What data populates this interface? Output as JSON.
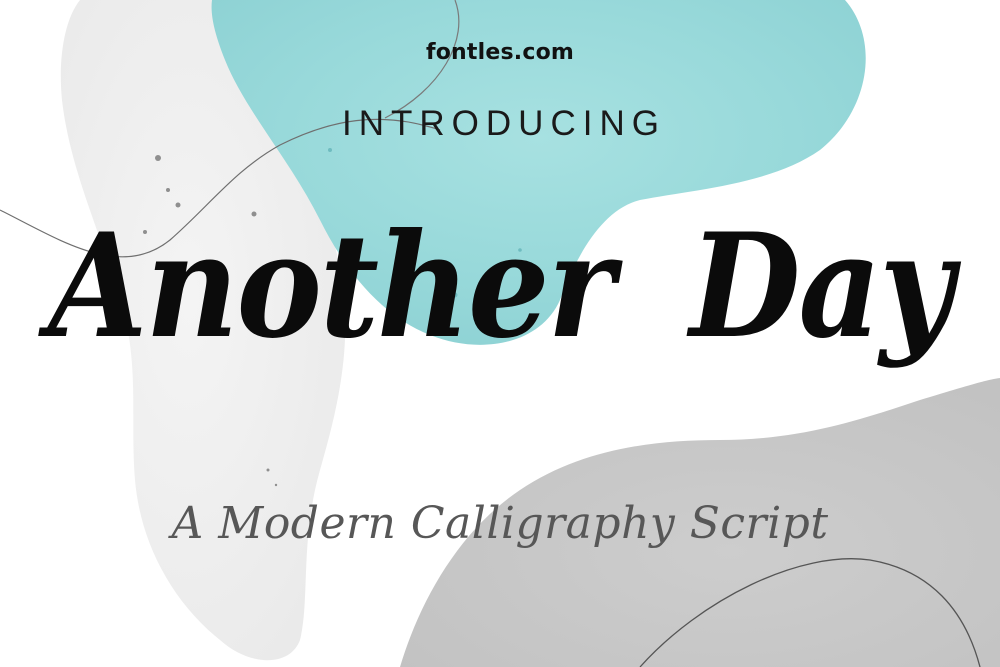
{
  "poster": {
    "site": "fontles.com",
    "intro": "INTRODUCING",
    "title": "Another Day",
    "subtitle": "A Modern Calligraphy Script"
  },
  "colors": {
    "teal_blob": "#9bdcdc",
    "light_gray_blob": "#efefef",
    "mid_gray_blob": "#c9c9c9",
    "title_text": "#0b0b0b",
    "subtitle_text": "#575757"
  }
}
